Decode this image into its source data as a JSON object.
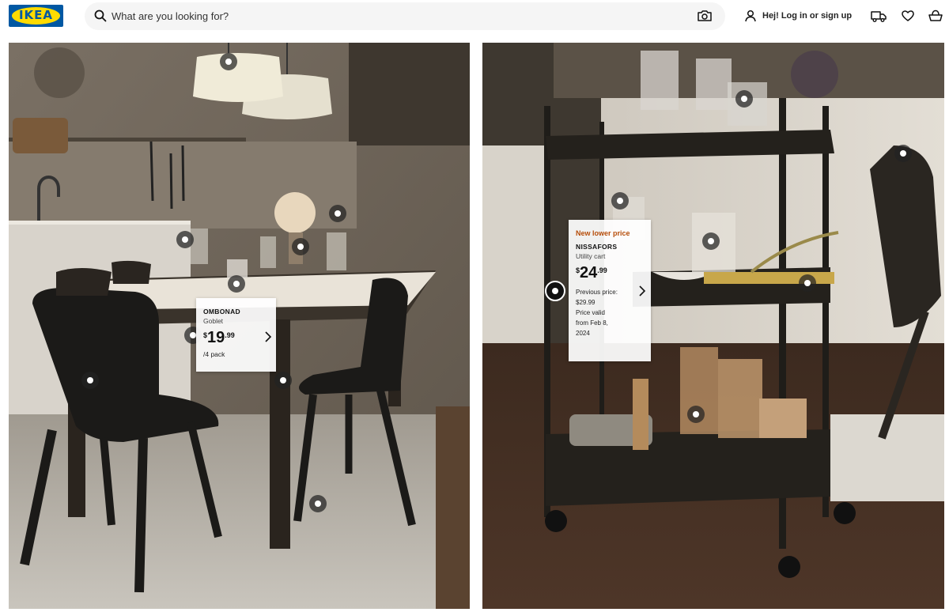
{
  "header": {
    "logo_text": "IKEA",
    "search_placeholder": "What are you looking for?",
    "search_icon": "search-icon",
    "camera_icon": "camera-icon",
    "login_label": "Hej! Log in or sign up",
    "user_icon": "user-icon",
    "delivery_icon": "truck-icon",
    "favourites_icon": "heart-icon",
    "cart_icon": "shopping-bag-icon"
  },
  "colors": {
    "ikea_blue": "#0058a3",
    "ikea_yellow": "#ffdb00",
    "new_lower_price": "#b64d0a"
  },
  "left_panel": {
    "card": {
      "name": "OMBONAD",
      "description": "Goblet",
      "price_currency": "$",
      "price_integer": "19",
      "price_decimal": ".99",
      "pack": "/4 pack"
    }
  },
  "right_panel": {
    "card": {
      "badge": "New lower price",
      "name": "NISSAFORS",
      "description": "Utility cart",
      "price_currency": "$",
      "price_integer": "24",
      "price_decimal": ".99",
      "previous_price_label": "Previous price:",
      "previous_price": "$29.99",
      "valid_line1": "Price valid",
      "valid_line2": "from Feb 8,",
      "valid_line3": "2024"
    }
  }
}
